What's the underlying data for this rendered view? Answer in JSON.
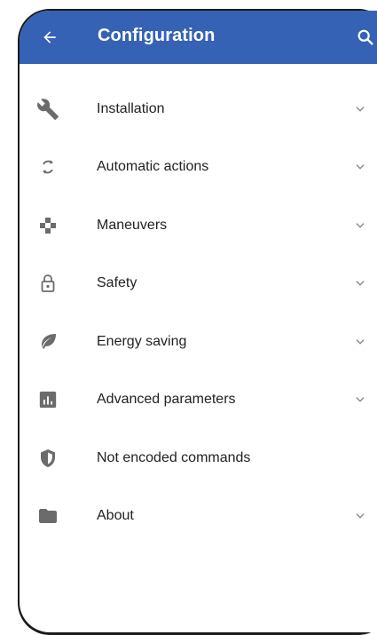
{
  "colors": {
    "appbar": "#3562b4",
    "icon": "#6b6b6b",
    "text": "#222222",
    "chevron": "#8a8a8a"
  },
  "appbar": {
    "title": "Configuration",
    "back_icon": "arrow-left-icon",
    "search_icon": "search-icon"
  },
  "menu": [
    {
      "label": "Installation",
      "icon": "wrench-icon",
      "expandable": true
    },
    {
      "label": "Automatic actions",
      "icon": "sync-icon",
      "expandable": true
    },
    {
      "label": "Maneuvers",
      "icon": "gamepad-icon",
      "expandable": true
    },
    {
      "label": "Safety",
      "icon": "lock-icon",
      "expandable": true
    },
    {
      "label": "Energy saving",
      "icon": "leaf-icon",
      "expandable": true
    },
    {
      "label": "Advanced parameters",
      "icon": "bar-chart-icon",
      "expandable": true
    },
    {
      "label": "Not encoded commands",
      "icon": "shield-icon",
      "expandable": false
    },
    {
      "label": "About",
      "icon": "folder-icon",
      "expandable": true
    }
  ]
}
